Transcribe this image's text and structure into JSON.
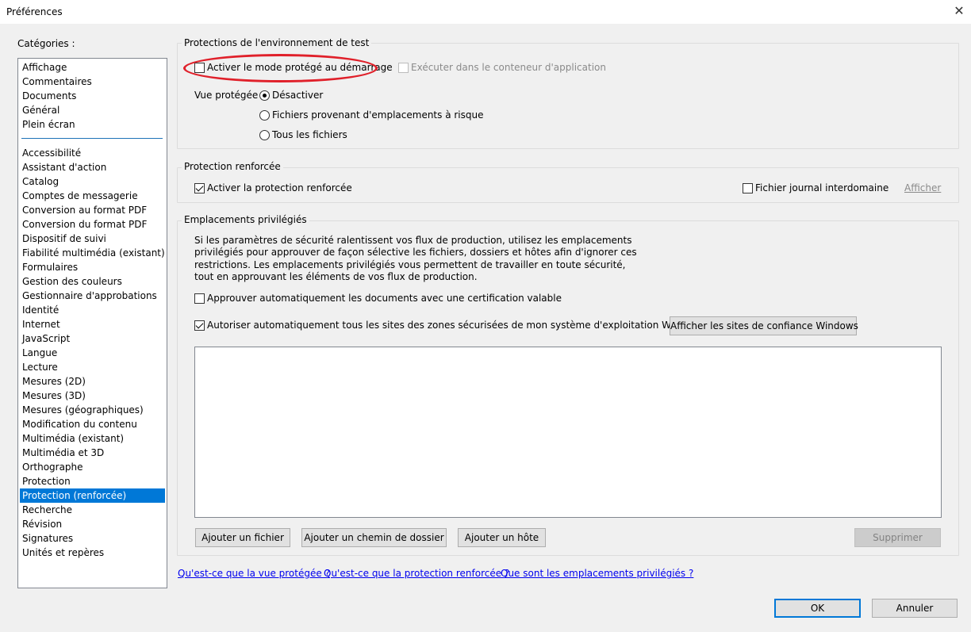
{
  "window": {
    "title": "Préférences",
    "close_glyph": "✕",
    "close_icon": "close-icon"
  },
  "categories": {
    "label": "Catégories :",
    "group_top": [
      "Affichage",
      "Commentaires",
      "Documents",
      "Général",
      "Plein écran"
    ],
    "group_bottom": [
      "Accessibilité",
      "Assistant d'action",
      "Catalog",
      "Comptes de messagerie",
      "Conversion au format PDF",
      "Conversion du format PDF",
      "Dispositif de suivi",
      "Fiabilité multimédia (existant)",
      "Formulaires",
      "Gestion des couleurs",
      "Gestionnaire d'approbations",
      "Identité",
      "Internet",
      "JavaScript",
      "Langue",
      "Lecture",
      "Mesures (2D)",
      "Mesures (3D)",
      "Mesures (géographiques)",
      "Modification du contenu",
      "Multimédia (existant)",
      "Multimédia et 3D",
      "Orthographe",
      "Protection",
      "Protection (renforcée)",
      "Recherche",
      "Révision",
      "Signatures",
      "Unités et repères"
    ],
    "selected": "Protection (renforcée)"
  },
  "sandbox": {
    "title": "Protections de l'environnement de test",
    "protected_mode_label": "Activer le mode protégé au démarrage",
    "protected_mode_checked": false,
    "app_container_label": "Exécuter dans le conteneur d'application",
    "app_container_checked": false,
    "app_container_enabled": false,
    "protected_view_label": "Vue protégée",
    "protected_view_options": [
      "Désactiver",
      "Fichiers provenant d'emplacements à risque",
      "Tous les fichiers"
    ],
    "protected_view_selected": "Désactiver"
  },
  "enhanced": {
    "title": "Protection renforcée",
    "enable_label": "Activer la protection renforcée",
    "enable_checked": true,
    "crossdomain_label": "Fichier journal interdomaine",
    "crossdomain_checked": false,
    "view_link": "Afficher"
  },
  "privileged": {
    "title": "Emplacements privilégiés",
    "description_lines": [
      "Si les paramètres de sécurité ralentissent vos flux de production, utilisez les emplacements",
      "privilégiés pour approuver de façon sélective les fichiers, dossiers et hôtes afin d'ignorer ces",
      "restrictions. Les emplacements privilégiés vous permettent de travailler en toute sécurité,",
      "tout en approuvant les éléments de vos flux de production."
    ],
    "auto_cert_label": "Approuver automatiquement les documents avec une certification valable",
    "auto_cert_checked": false,
    "auto_sites_label": "Autoriser automatiquement tous les sites des zones sécurisées de mon système d'exploitation Windows",
    "auto_sites_checked": true,
    "show_sites_button": "Afficher les sites de confiance Windows",
    "add_file_button": "Ajouter un fichier",
    "add_folder_button": "Ajouter un chemin de dossier",
    "add_host_button": "Ajouter un hôte",
    "remove_button": "Supprimer"
  },
  "help_links": [
    "Qu'est-ce que la vue protégée ?",
    "Qu'est-ce que la protection renforcée ?",
    "Que sont les emplacements privilégiés ?"
  ],
  "footer": {
    "ok_button": "OK",
    "cancel_button": "Annuler"
  },
  "colors": {
    "selection": "#0078d7",
    "annotation_ring": "#e0202a",
    "link": "#0000ee"
  }
}
